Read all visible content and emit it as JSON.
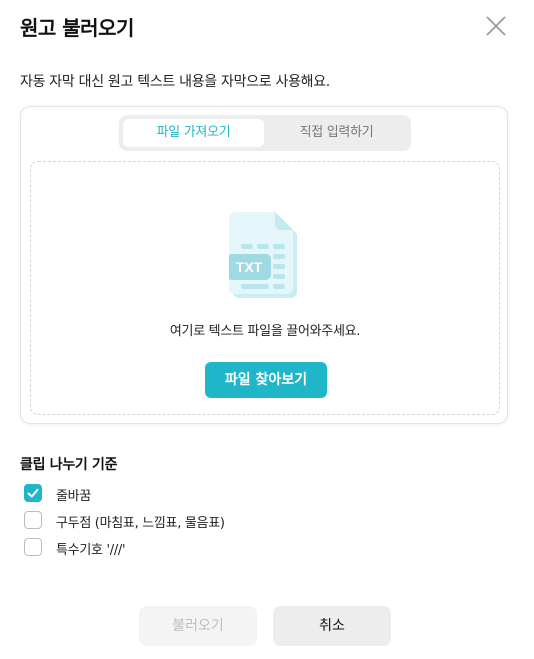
{
  "dialog": {
    "title": "원고 불러오기",
    "description": "자동 자막 대신 원고 텍스트 내용을 자막으로 사용해요."
  },
  "tabs": [
    {
      "label": "파일 가져오기",
      "active": true
    },
    {
      "label": "직접 입력하기",
      "active": false
    }
  ],
  "dropzone": {
    "icon_label": "TXT",
    "hint": "여기로 텍스트 파일을 끌어와주세요.",
    "browse_label": "파일 찾아보기"
  },
  "clip_split": {
    "title": "클립 나누기 기준",
    "options": [
      {
        "label": "줄바꿈",
        "checked": true
      },
      {
        "label": "구두점 (마침표, 느낌표, 물음표)",
        "checked": false
      },
      {
        "label": "특수기호 '///'",
        "checked": false
      }
    ]
  },
  "footer": {
    "load_label": "불러오기",
    "load_enabled": false,
    "cancel_label": "취소"
  },
  "colors": {
    "accent": "#1fb6c9",
    "icon_light": "#dff4f8",
    "icon_mid": "#b7e6ee"
  }
}
